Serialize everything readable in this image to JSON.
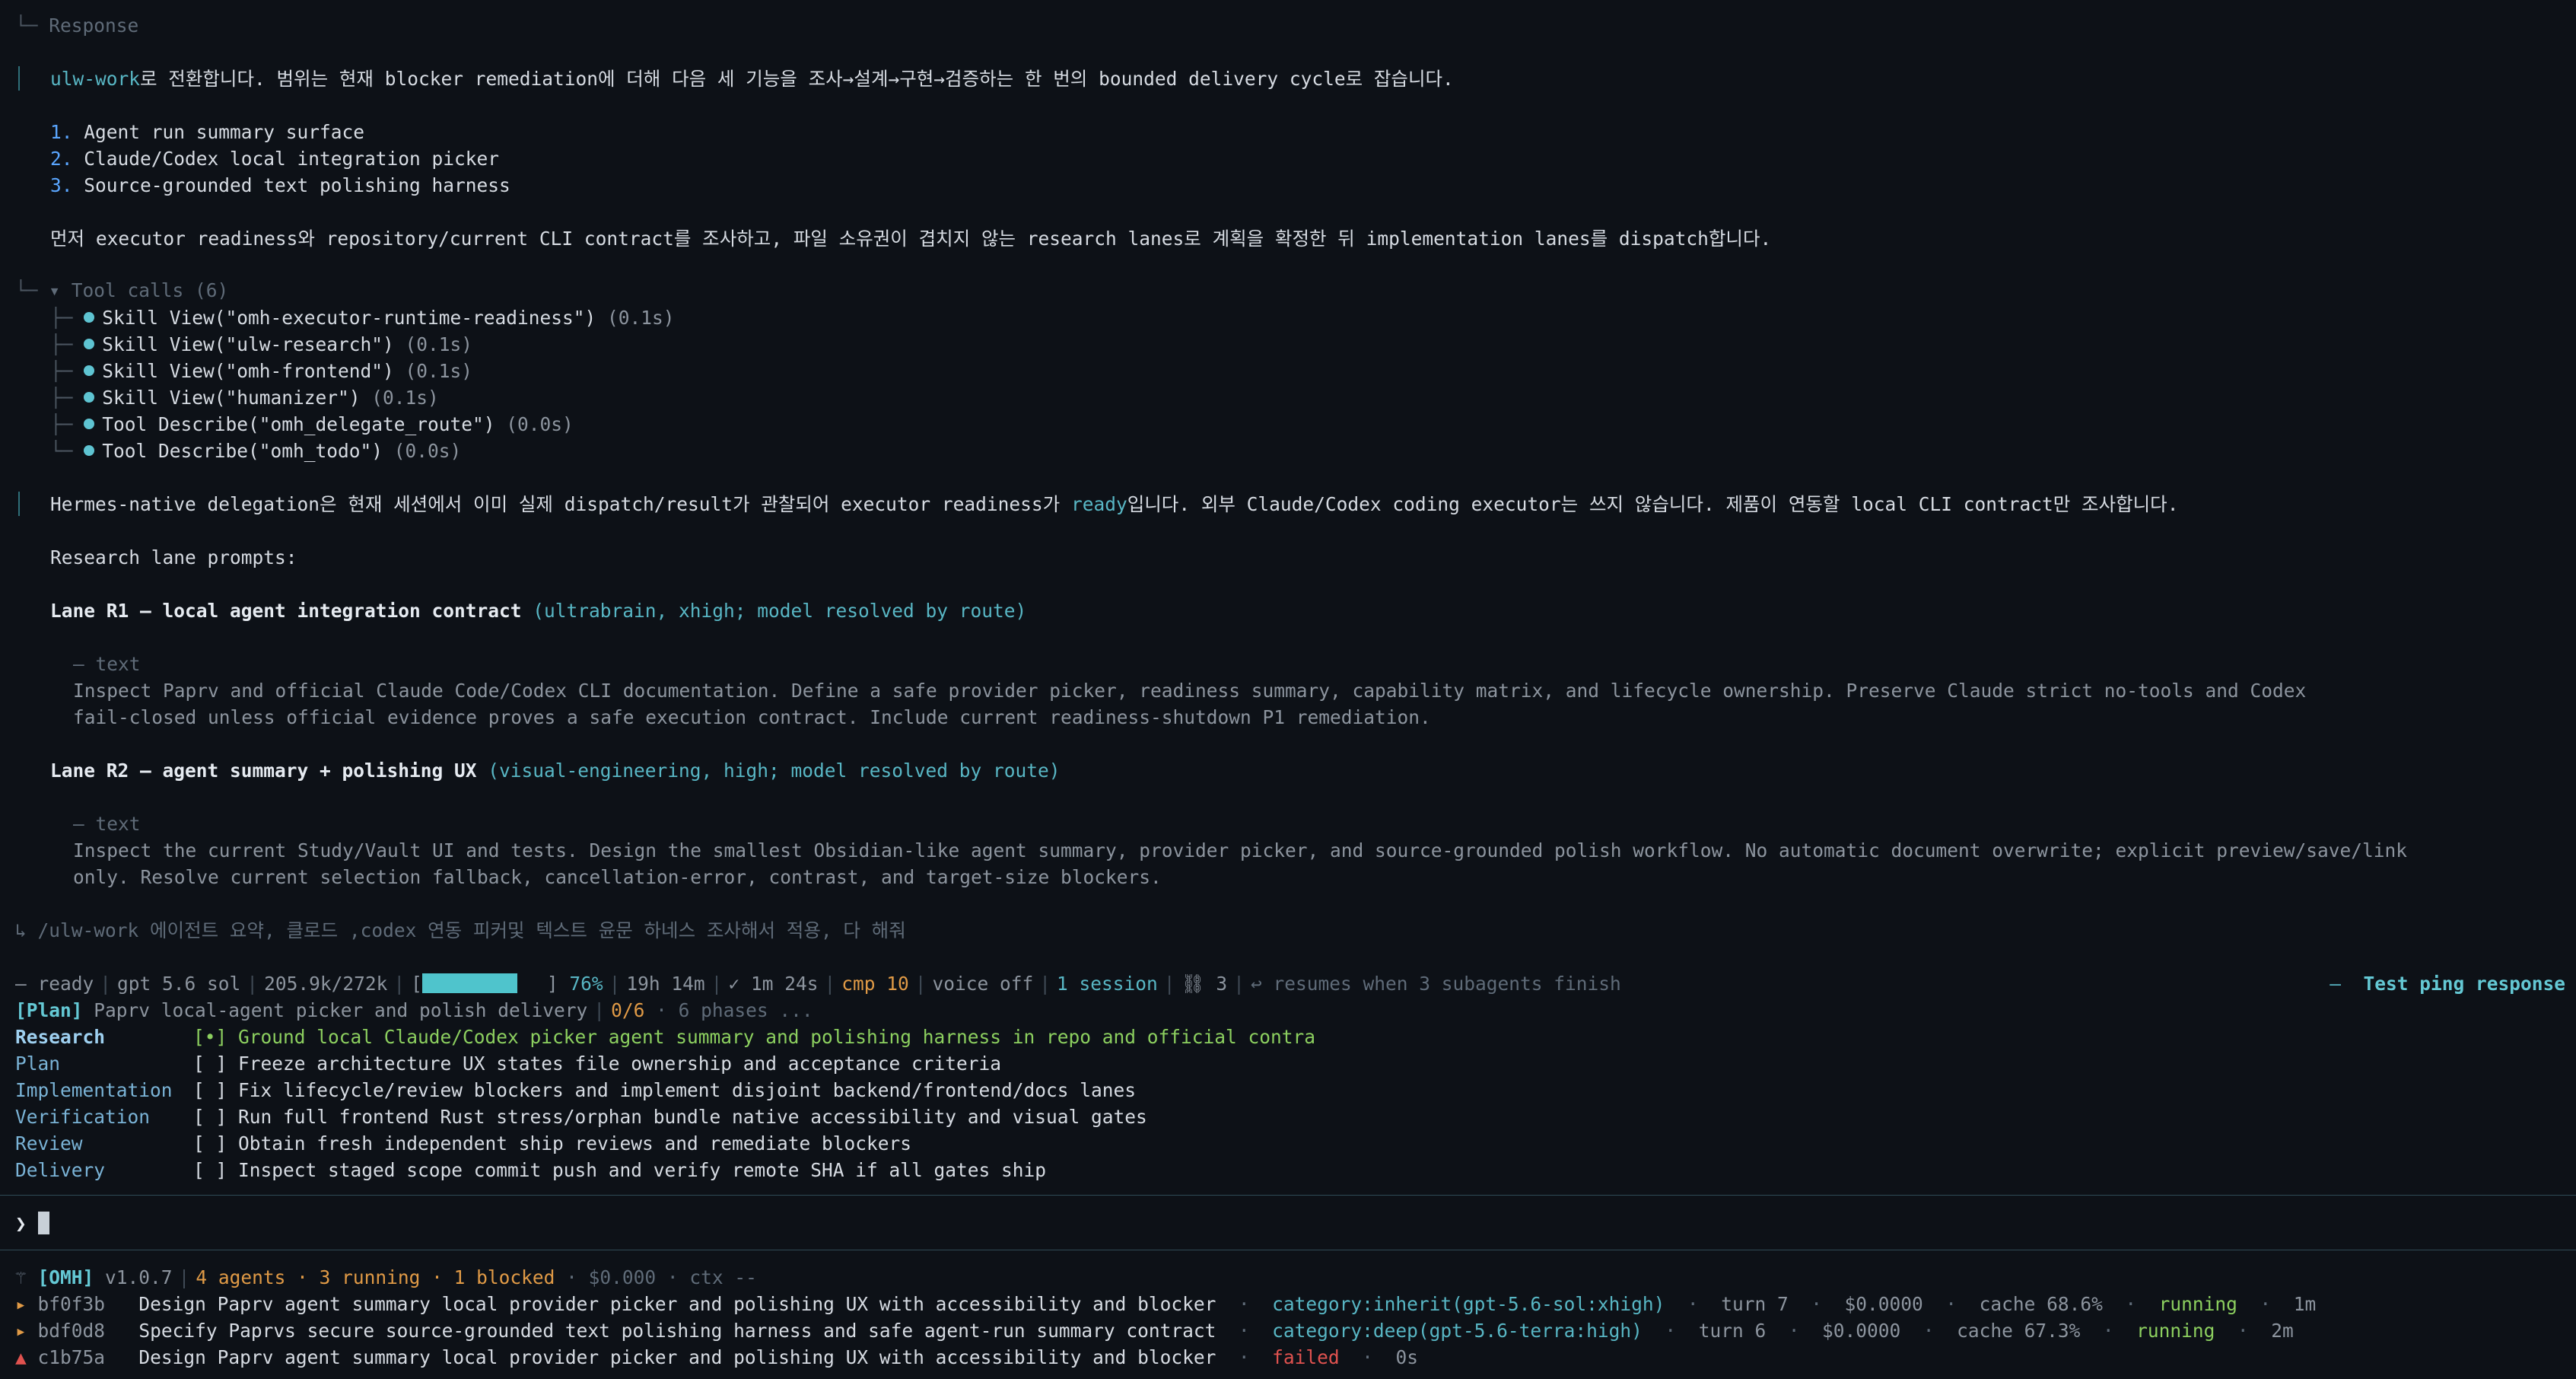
{
  "response_header": "Response",
  "intro": {
    "prefix": "ulw-work",
    "text": "로 전환합니다. 범위는 현재 blocker remediation에 더해 다음 세 기능을 조사→설계→구현→검증하는 한 번의 bounded delivery cycle로 잡습니다."
  },
  "features": [
    "Agent run summary surface",
    "Claude/Codex local integration picker",
    "Source-grounded text polishing harness"
  ],
  "plan_line": "먼저 executor readiness와 repository/current CLI contract를 조사하고, 파일 소유권이 겹치지 않는 research lanes로 계획을 확정한 뒤 implementation lanes를 dispatch합니다.",
  "tool_calls": {
    "header": "▾ Tool calls (6)",
    "items": [
      {
        "name": "Skill View(\"omh-executor-runtime-readiness\")",
        "time": "(0.1s)"
      },
      {
        "name": "Skill View(\"ulw-research\")",
        "time": "(0.1s)"
      },
      {
        "name": "Skill View(\"omh-frontend\")",
        "time": "(0.1s)"
      },
      {
        "name": "Skill View(\"humanizer\")",
        "time": "(0.1s)"
      },
      {
        "name": "Tool Describe(\"omh_delegate_route\")",
        "time": "(0.0s)"
      },
      {
        "name": "Tool Describe(\"omh_todo\")",
        "time": "(0.0s)"
      }
    ]
  },
  "hermes": {
    "before": "Hermes-native delegation은 현재 세션에서 이미 실제 dispatch/result가 관찰되어 executor readiness가 ",
    "ready": "ready",
    "after": "입니다. 외부 Claude/Codex coding executor는 쓰지 않습니다. 제품이 연동할 local CLI contract만 조사합니다."
  },
  "research_prompts_label": "Research lane prompts:",
  "lanes": [
    {
      "title": "Lane R1 — local agent integration contract",
      "meta": "(ultrabrain, xhigh; model resolved by route)",
      "kind": "— text",
      "body1": "Inspect Paprv and official Claude Code/Codex CLI documentation. Define a safe provider picker, readiness summary, capability matrix, and lifecycle ownership. Preserve Claude strict no-tools and Codex",
      "body2": "fail-closed unless official evidence proves a safe execution contract. Include current readiness-shutdown P1 remediation."
    },
    {
      "title": "Lane R2 — agent summary + polishing UX",
      "meta": "(visual-engineering, high; model resolved by route)",
      "kind": "— text",
      "body1": "Inspect the current Study/Vault UI and tests. Design the smallest Obsidian-like agent summary, provider picker, and source-grounded polish workflow. No automatic document overwrite; explicit preview/save/link",
      "body2": "only. Resolve current selection fallback, cancellation-error, contrast, and target-size blockers."
    }
  ],
  "user_prompt": "↳ /ulw-work 에이전트 요약, 클로드 ,codex 연동 피커및 텍스트 윤문 하네스 조사해서 적용, 다 해줘",
  "status": {
    "ready": "– ready",
    "model": "gpt 5.6 sol",
    "tokens": "205.9k/272k",
    "ctx_pct": "76%",
    "ctx_fill": 0.76,
    "elapsed": "19h 14m",
    "check": "✓ 1m 24s",
    "cmp": "cmp 10",
    "voice": "voice off",
    "session": "1 session",
    "links": "⛓ 3",
    "resume": "↩ resumes when 3 subagents finish",
    "ping": "Test ping response"
  },
  "plan": {
    "tag": "[Plan]",
    "title": "Paprv local-agent picker and polish delivery",
    "progress": "0/6",
    "phases": "· 6 phases ...",
    "rows": [
      {
        "phase": "Research",
        "box": "[•]",
        "text": "Ground local Claude/Codex picker agent summary and polishing harness in repo and official contra"
      },
      {
        "phase": "Plan",
        "box": "[ ]",
        "text": "Freeze architecture UX states file ownership and acceptance criteria"
      },
      {
        "phase": "Implementation",
        "box": "[ ]",
        "text": "Fix lifecycle/review blockers and implement disjoint backend/frontend/docs lanes"
      },
      {
        "phase": "Verification",
        "box": "[ ]",
        "text": "Run full frontend Rust stress/orphan bundle native accessibility and visual gates"
      },
      {
        "phase": "Review",
        "box": "[ ]",
        "text": "Obtain fresh independent ship reviews and remediate blockers"
      },
      {
        "phase": "Delivery",
        "box": "[ ]",
        "text": "Inspect staged scope commit push and verify remote SHA if all gates ship"
      }
    ]
  },
  "prompt_symbol": "❯",
  "omh": {
    "tag": "[OMH]",
    "version": "v1.0.7",
    "agents": "4 agents · 3 running · 1 blocked",
    "cost": "· $0.000 · ctx --",
    "rows": [
      {
        "mark": "▸",
        "id": "bf0f3b",
        "task": "Design Paprv agent summary local provider picker and polishing UX with accessibility and blocker",
        "category": "category:inherit(gpt-5.6-sol:xhigh)",
        "turn": "turn 7",
        "cost": "$0.0000",
        "cache": "cache 68.6%",
        "state": "running",
        "time": "1m"
      },
      {
        "mark": "▸",
        "id": "bdf0d8",
        "task": "Specify Paprvs secure source-grounded text polishing harness and safe agent-run summary contract",
        "category": "category:deep(gpt-5.6-terra:high)",
        "turn": "turn 6",
        "cost": "$0.0000",
        "cache": "cache 67.3%",
        "state": "running",
        "time": "2m"
      },
      {
        "mark": "▲",
        "id": "c1b75a",
        "task": "Design Paprv agent summary local provider picker and polishing UX with accessibility and blocker",
        "state": "failed",
        "time": "0s"
      }
    ]
  }
}
